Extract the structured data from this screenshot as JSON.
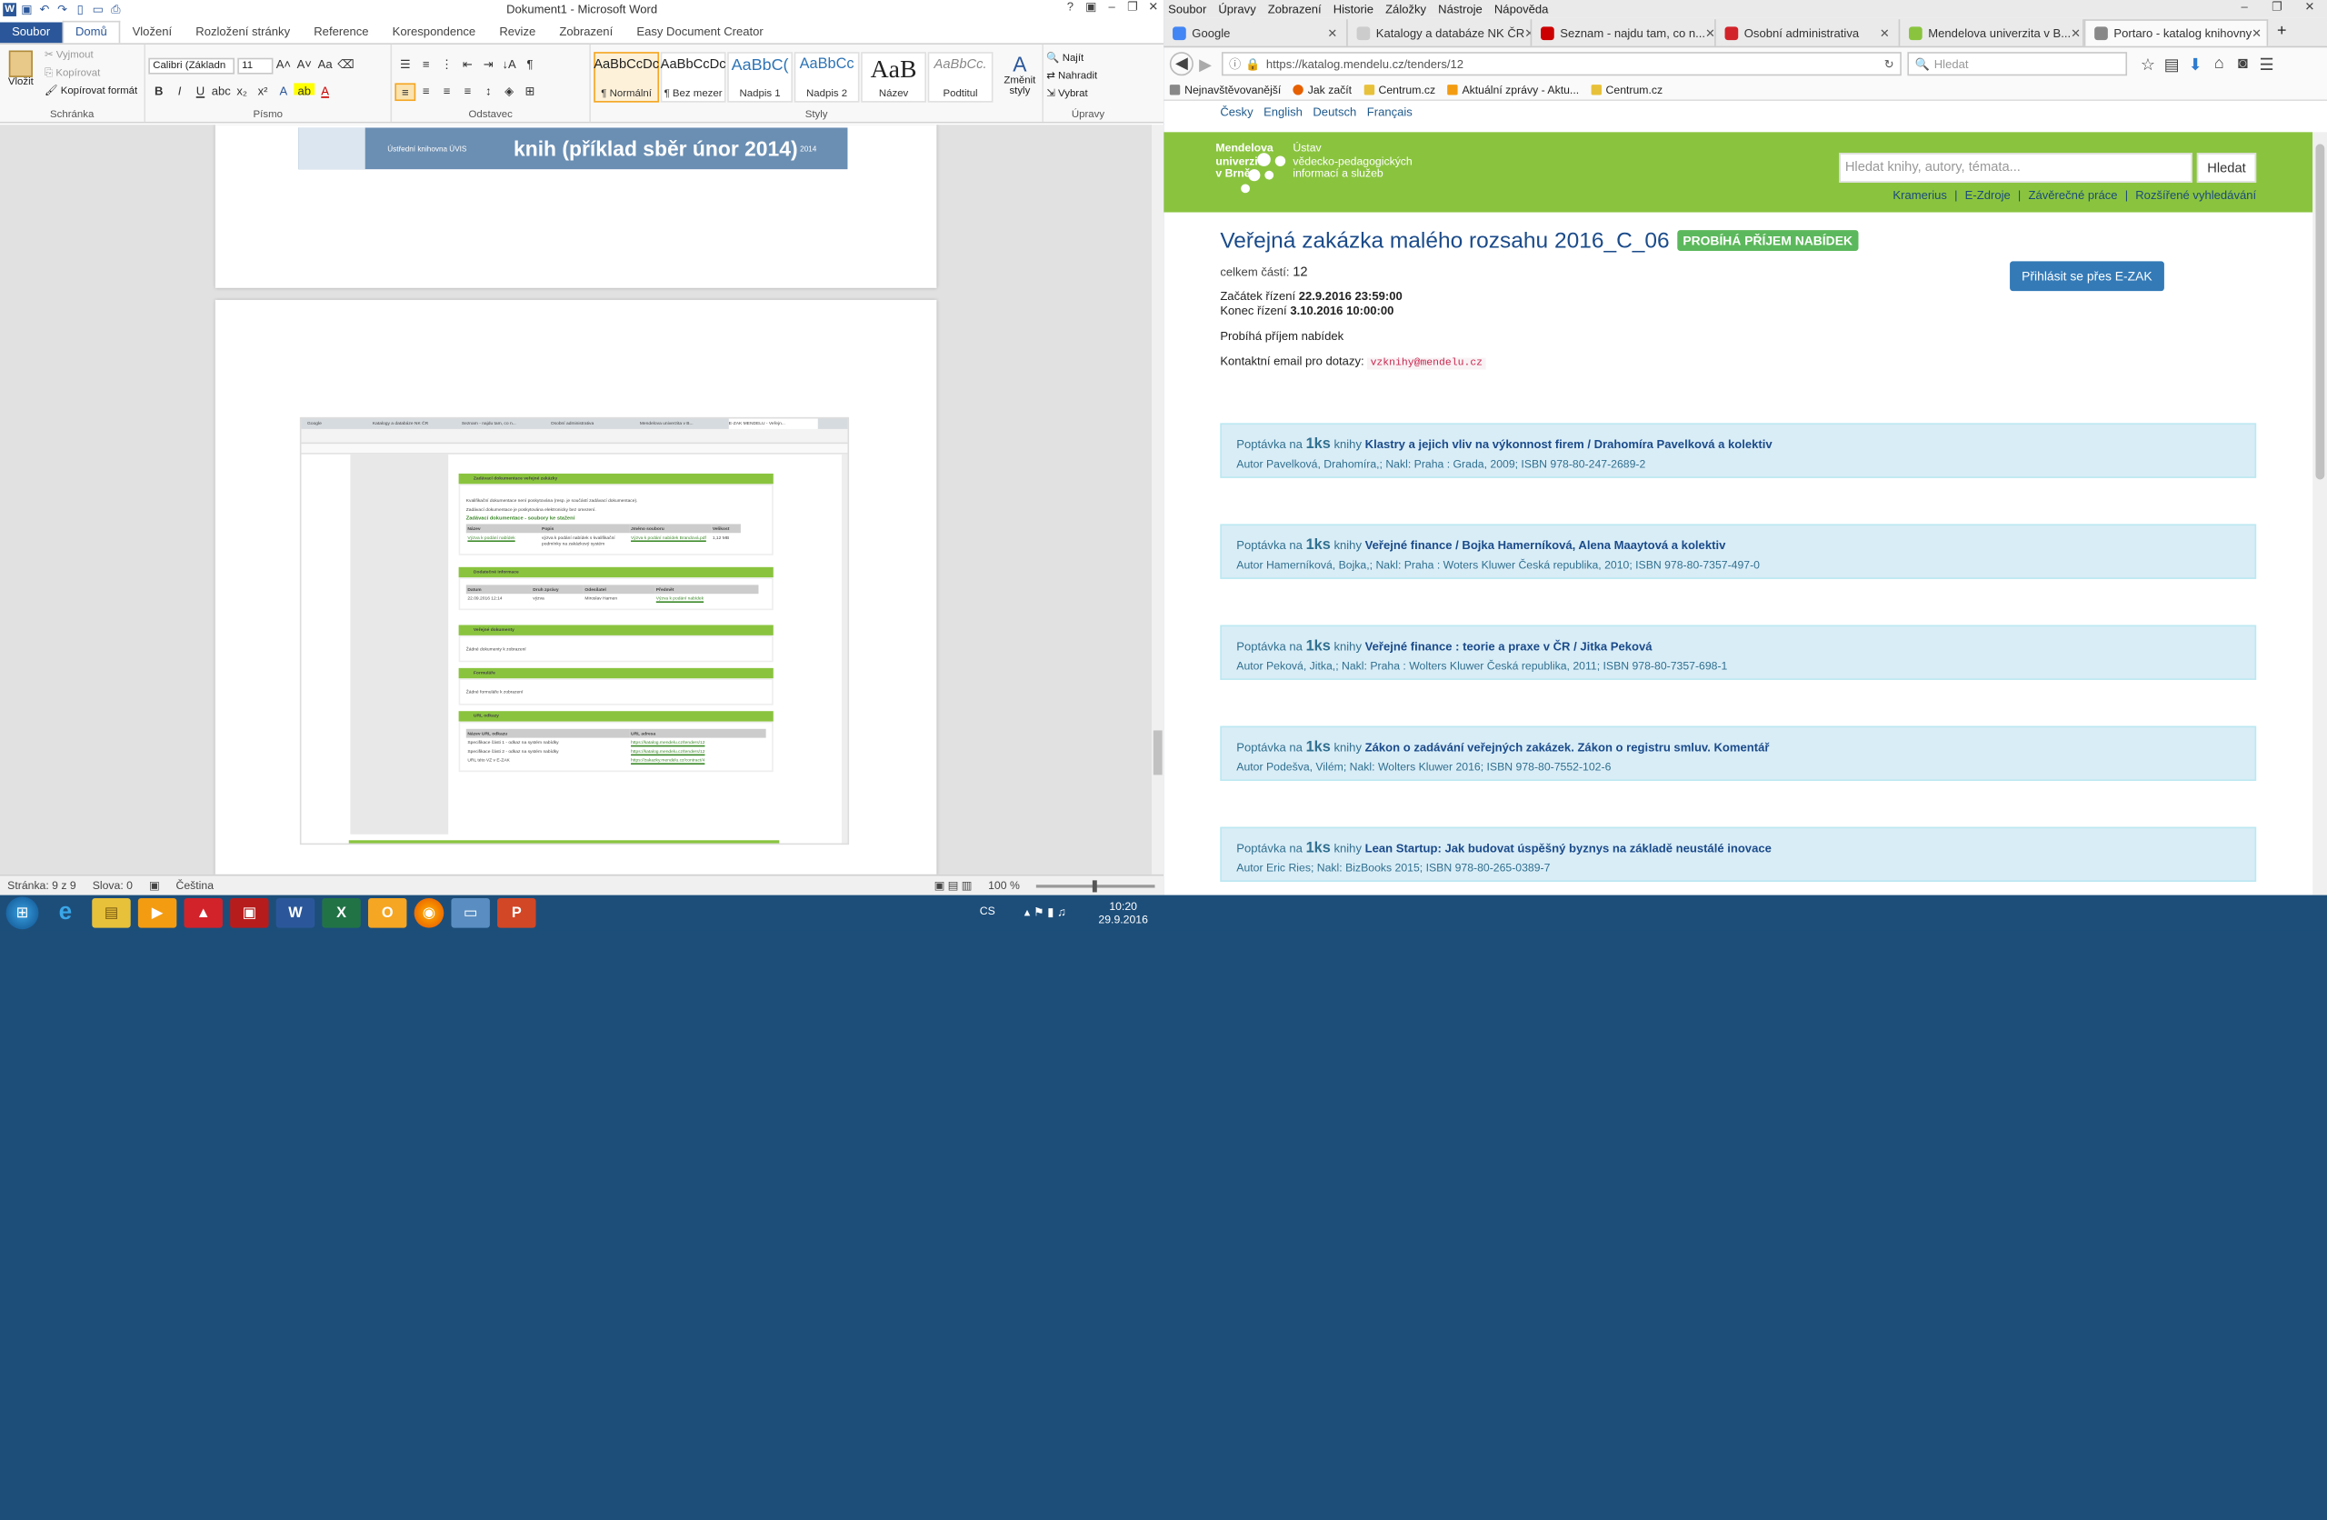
{
  "word": {
    "title": "Dokument1 - Microsoft Word",
    "tabs": [
      "Soubor",
      "Domů",
      "Vložení",
      "Rozložení stránky",
      "Reference",
      "Korespondence",
      "Revize",
      "Zobrazení",
      "Easy Document Creator"
    ],
    "clipboard": {
      "paste": "Vložit",
      "cut": "Vyjmout",
      "copy": "Kopírovat",
      "format": "Kopírovat formát",
      "label": "Schránka"
    },
    "font": {
      "name": "Calibri (Základn",
      "size": "11",
      "label": "Písmo"
    },
    "paragraph_label": "Odstavec",
    "styles": [
      {
        "preview": "AaBbCcDc",
        "name": "¶ Normální"
      },
      {
        "preview": "AaBbCcDc",
        "name": "¶ Bez mezer"
      },
      {
        "preview": "AaBbC(",
        "name": "Nadpis 1"
      },
      {
        "preview": "AaBbCc",
        "name": "Nadpis 2"
      },
      {
        "preview": "AaB",
        "name": "Název"
      },
      {
        "preview": "AaBbCc.",
        "name": "Podtitul"
      }
    ],
    "change_styles": "Změnit styly",
    "styles_label": "Styly",
    "editing": {
      "find": "Najít",
      "replace": "Nahradit",
      "select": "Vybrat",
      "label": "Úpravy"
    },
    "page1_image_text": "knih (příklad sběr únor 2014)",
    "page1_image_small": "Ústřední knihovna ÚVIS",
    "page1_image_year": "2014",
    "status": {
      "page": "Stránka: 9 z 9",
      "words": "Slova: 0",
      "lang": "Čeština",
      "zoom": "100 %"
    },
    "embedded": {
      "section1": "Zadávací dokumentace veřejné zakázky",
      "section1_text1": "Kvalifikační dokumentace není poskytována (resp. je součástí zadávací dokumentace).",
      "section1_text2": "Zadávací dokumentace je poskytována elektronicky bez omezení.",
      "section1_sub": "Zadávací dokumentace - soubory ke stažení",
      "table1_headers": [
        "Název",
        "Popis",
        "Jméno souboru",
        "Velikost"
      ],
      "table1_row": [
        "Výzva k podání nabídek",
        "výzva k podání nabídek s kvalifikační podmínky na zakázkový systém",
        "Výzva k podání nabídek Brandová.pdf",
        "1,12 MB"
      ],
      "section2": "Dodatečné informace",
      "table2_headers": [
        "Datum",
        "Druh zprávy",
        "Odesílatel",
        "Předmět"
      ],
      "table2_row": [
        "22.09.2016 12:14",
        "výzva",
        "Miroslav Harnen",
        "Výzva k podání nabídek"
      ],
      "section3": "Veřejné dokumenty",
      "section3_text": "Žádné dokumenty k zobrazení",
      "section4": "Formuláře",
      "section4_text": "Žádné formuláře k zobrazení",
      "section5": "URL odkazy",
      "table5_headers": [
        "Název URL odkazu",
        "URL adresa"
      ],
      "table5_rows": [
        [
          "Specifikace části 1 - odkaz na systém nabídky",
          "https://katalog.mendelu.cz/tenders/12"
        ],
        [
          "Specifikace části 2 - odkaz na systém nabídky",
          "https://katalog.mendelu.cz/tenders/12"
        ],
        [
          "URL této VZ v E-ZAK",
          "https://zakazky.mendelu.cz/contract/4"
        ]
      ],
      "mini_tabs": [
        "Google",
        "Katalogy a databáze NK ČR",
        "Seznam - najdu tam, co n...",
        "Osobní administrativa",
        "Mendelova univerzita v B...",
        "E-ZAK MENDELU - Veřejn..."
      ]
    }
  },
  "firefox": {
    "menu": [
      "Soubor",
      "Úpravy",
      "Zobrazení",
      "Historie",
      "Záložky",
      "Nástroje",
      "Nápověda"
    ],
    "tabs": [
      {
        "label": "Google",
        "color": "#4285f4"
      },
      {
        "label": "Katalogy a databáze NK ČR",
        "color": "#cccccc"
      },
      {
        "label": "Seznam - najdu tam, co n...",
        "color": "#cc0000"
      },
      {
        "label": "Osobní administrativa",
        "color": "#d2232a"
      },
      {
        "label": "Mendelova univerzita v B...",
        "color": "#8ac43f"
      },
      {
        "label": "Portaro - katalog knihovny",
        "color": "#888888"
      }
    ],
    "url": "https://katalog.mendelu.cz/tenders/12",
    "search_placeholder": "Hledat",
    "bookmarks": [
      "Nejnavštěvovanější",
      "Jak začít",
      "Centrum.cz",
      "Aktuální zprávy - Aktu...",
      "Centrum.cz"
    ],
    "langs": [
      "Česky",
      "English",
      "Deutsch",
      "Français"
    ],
    "logo_left": [
      "Mendelova",
      "univerzita",
      "v Brně"
    ],
    "logo_right": [
      "Ústav",
      "vědecko-pedagogických",
      "informací a služeb"
    ],
    "search_placeholder_site": "Hledat knihy, autory, témata...",
    "search_button": "Hledat",
    "links": [
      "Kramerius",
      "|",
      "E-Zdroje",
      "|",
      "Závěrečné práce",
      "|",
      "Rozšířené vyhledávání"
    ],
    "title": "Veřejná zakázka malého rozsahu 2016_C_06",
    "badge": "PROBÍHÁ PŘÍJEM NABÍDEK",
    "parts_label": "celkem částí:",
    "parts": "12",
    "start_label": "Začátek řízení",
    "start": "22.9.2016 23:59:00",
    "end_label": "Konec řízení",
    "end": "3.10.2016 10:00:00",
    "state": "Probíhá příjem nabídek",
    "email_label": "Kontaktní email pro dotazy:",
    "email": "vzknihy@mendelu.cz",
    "login_button": "Přihlásit se přes E-ZAK",
    "requests": [
      {
        "pre": "Poptávka na",
        "qty": "1ks",
        "unit": "knihy",
        "title": "Klastry a jejich vliv na výkonnost firem / Drahomíra Pavelková a kolektiv",
        "detail": "Autor Pavelková, Drahomíra,; Nakl: Praha : Grada, 2009; ISBN 978-80-247-2689-2"
      },
      {
        "pre": "Poptávka na",
        "qty": "1ks",
        "unit": "knihy",
        "title": "Veřejné finance / Bojka Hamerníková, Alena Maaytová a kolektiv",
        "detail": "Autor Hamerníková, Bojka,; Nakl: Praha : Woters Kluwer Česká republika, 2010; ISBN 978-80-7357-497-0"
      },
      {
        "pre": "Poptávka na",
        "qty": "1ks",
        "unit": "knihy",
        "title": "Veřejné finance : teorie a praxe v ČR / Jitka Peková",
        "detail": "Autor Peková, Jitka,; Nakl: Praha : Wolters Kluwer Česká republika, 2011; ISBN 978-80-7357-698-1"
      },
      {
        "pre": "Poptávka na",
        "qty": "1ks",
        "unit": "knihy",
        "title": "Zákon o zadávání veřejných zakázek. Zákon o registru smluv. Komentář",
        "detail": "Autor Podešva, Vilém; Nakl: Wolters Kluwer 2016; ISBN 978-80-7552-102-6"
      },
      {
        "pre": "Poptávka na",
        "qty": "1ks",
        "unit": "knihy",
        "title": "Lean Startup: Jak budovat úspěšný byznys na základě neustálé inovace",
        "detail": "Autor Eric Ries; Nakl: BizBooks 2015; ISBN 978-80-265-0389-7"
      }
    ]
  },
  "taskbar": {
    "lang": "CS",
    "time": "10:20",
    "date": "29.9.2016"
  }
}
